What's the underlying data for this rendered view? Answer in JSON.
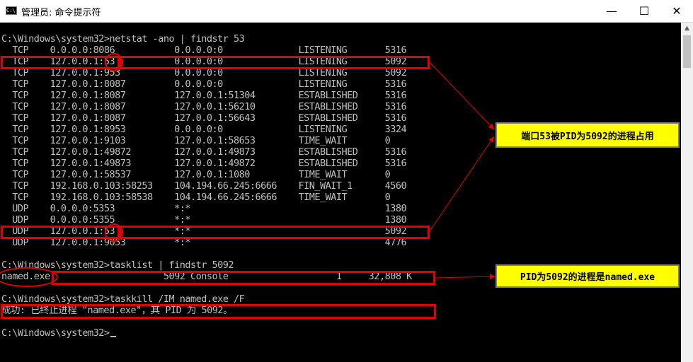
{
  "window": {
    "title": "管理员: 命令提示符",
    "icon_label": "C:\\",
    "minimize": "—",
    "maximize": "☐",
    "close": "✕"
  },
  "console": {
    "lines": [
      "C:\\Windows\\system32>netstat -ano | findstr 53",
      "  TCP    0.0.0.0:8086           0.0.0.0:0              LISTENING       5316",
      "  TCP    127.0.0.1:53           0.0.0.0:0              LISTENING       5092",
      "  TCP    127.0.0.1:953          0.0.0.0:0              LISTENING       5092",
      "  TCP    127.0.0.1:8087         0.0.0.0:0              LISTENING       5316",
      "  TCP    127.0.0.1:8087         127.0.0.1:51304        ESTABLISHED     5316",
      "  TCP    127.0.0.1:8087         127.0.0.1:56210        ESTABLISHED     5316",
      "  TCP    127.0.0.1:8087         127.0.0.1:56643        ESTABLISHED     5316",
      "  TCP    127.0.0.1:8953         0.0.0.0:0              LISTENING       3324",
      "  TCP    127.0.0.1:9103         127.0.0.1:58653        TIME_WAIT       0",
      "  TCP    127.0.0.1:49872        127.0.0.1:49873        ESTABLISHED     5316",
      "  TCP    127.0.0.1:49873        127.0.0.1:49872        ESTABLISHED     5316",
      "  TCP    127.0.0.1:58537        127.0.0.1:1080         TIME_WAIT       0",
      "  TCP    192.168.0.103:58253    104.194.66.245:6666    FIN_WAIT_1      4560",
      "  TCP    192.168.0.103:58538    104.194.66.245:6666    TIME_WAIT       0",
      "  UDP    0.0.0.0:5353           *:*                                    1380",
      "  UDP    0.0.0.0:5355           *:*                                    1380",
      "  UDP    127.0.0.1:53           *:*                                    5092",
      "  UDP    127.0.0.1:9053         *:*                                    4776",
      "",
      "C:\\Windows\\system32>tasklist | findstr 5092",
      "named.exe                     5092 Console                    1     32,808 K",
      "",
      "C:\\Windows\\system32>taskkill /IM named.exe /F",
      "成功: 已终止进程 \"named.exe\"，其 PID 为 5092。",
      ""
    ],
    "prompt": "C:\\Windows\\system32>"
  },
  "annotations": {
    "callout_port": "端口53被PID为5092的进程占用",
    "callout_process": "PID为5092的进程是named.exe"
  },
  "colors": {
    "console_bg": "#000000",
    "console_fg": "#c0c0c0",
    "highlight": "#e00000",
    "callout_bg": "#ffff00"
  }
}
